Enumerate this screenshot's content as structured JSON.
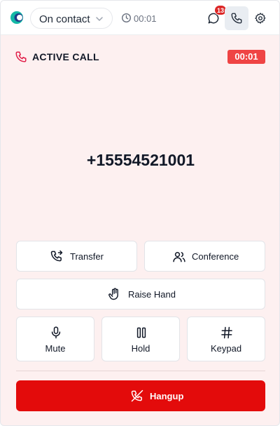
{
  "header": {
    "status_label": "On contact",
    "elapsed": "00:01",
    "notification_count": "13",
    "accent_color": "#14b8a6"
  },
  "call": {
    "title": "ACTIVE CALL",
    "timer": "00:01",
    "number": "+15554521001"
  },
  "actions": {
    "transfer": "Transfer",
    "conference": "Conference",
    "raise_hand": "Raise Hand",
    "mute": "Mute",
    "hold": "Hold",
    "keypad": "Keypad",
    "hangup": "Hangup"
  },
  "colors": {
    "hangup": "#e30b0b",
    "call_timer": "#ef4444",
    "background": "#fdf0f0"
  }
}
